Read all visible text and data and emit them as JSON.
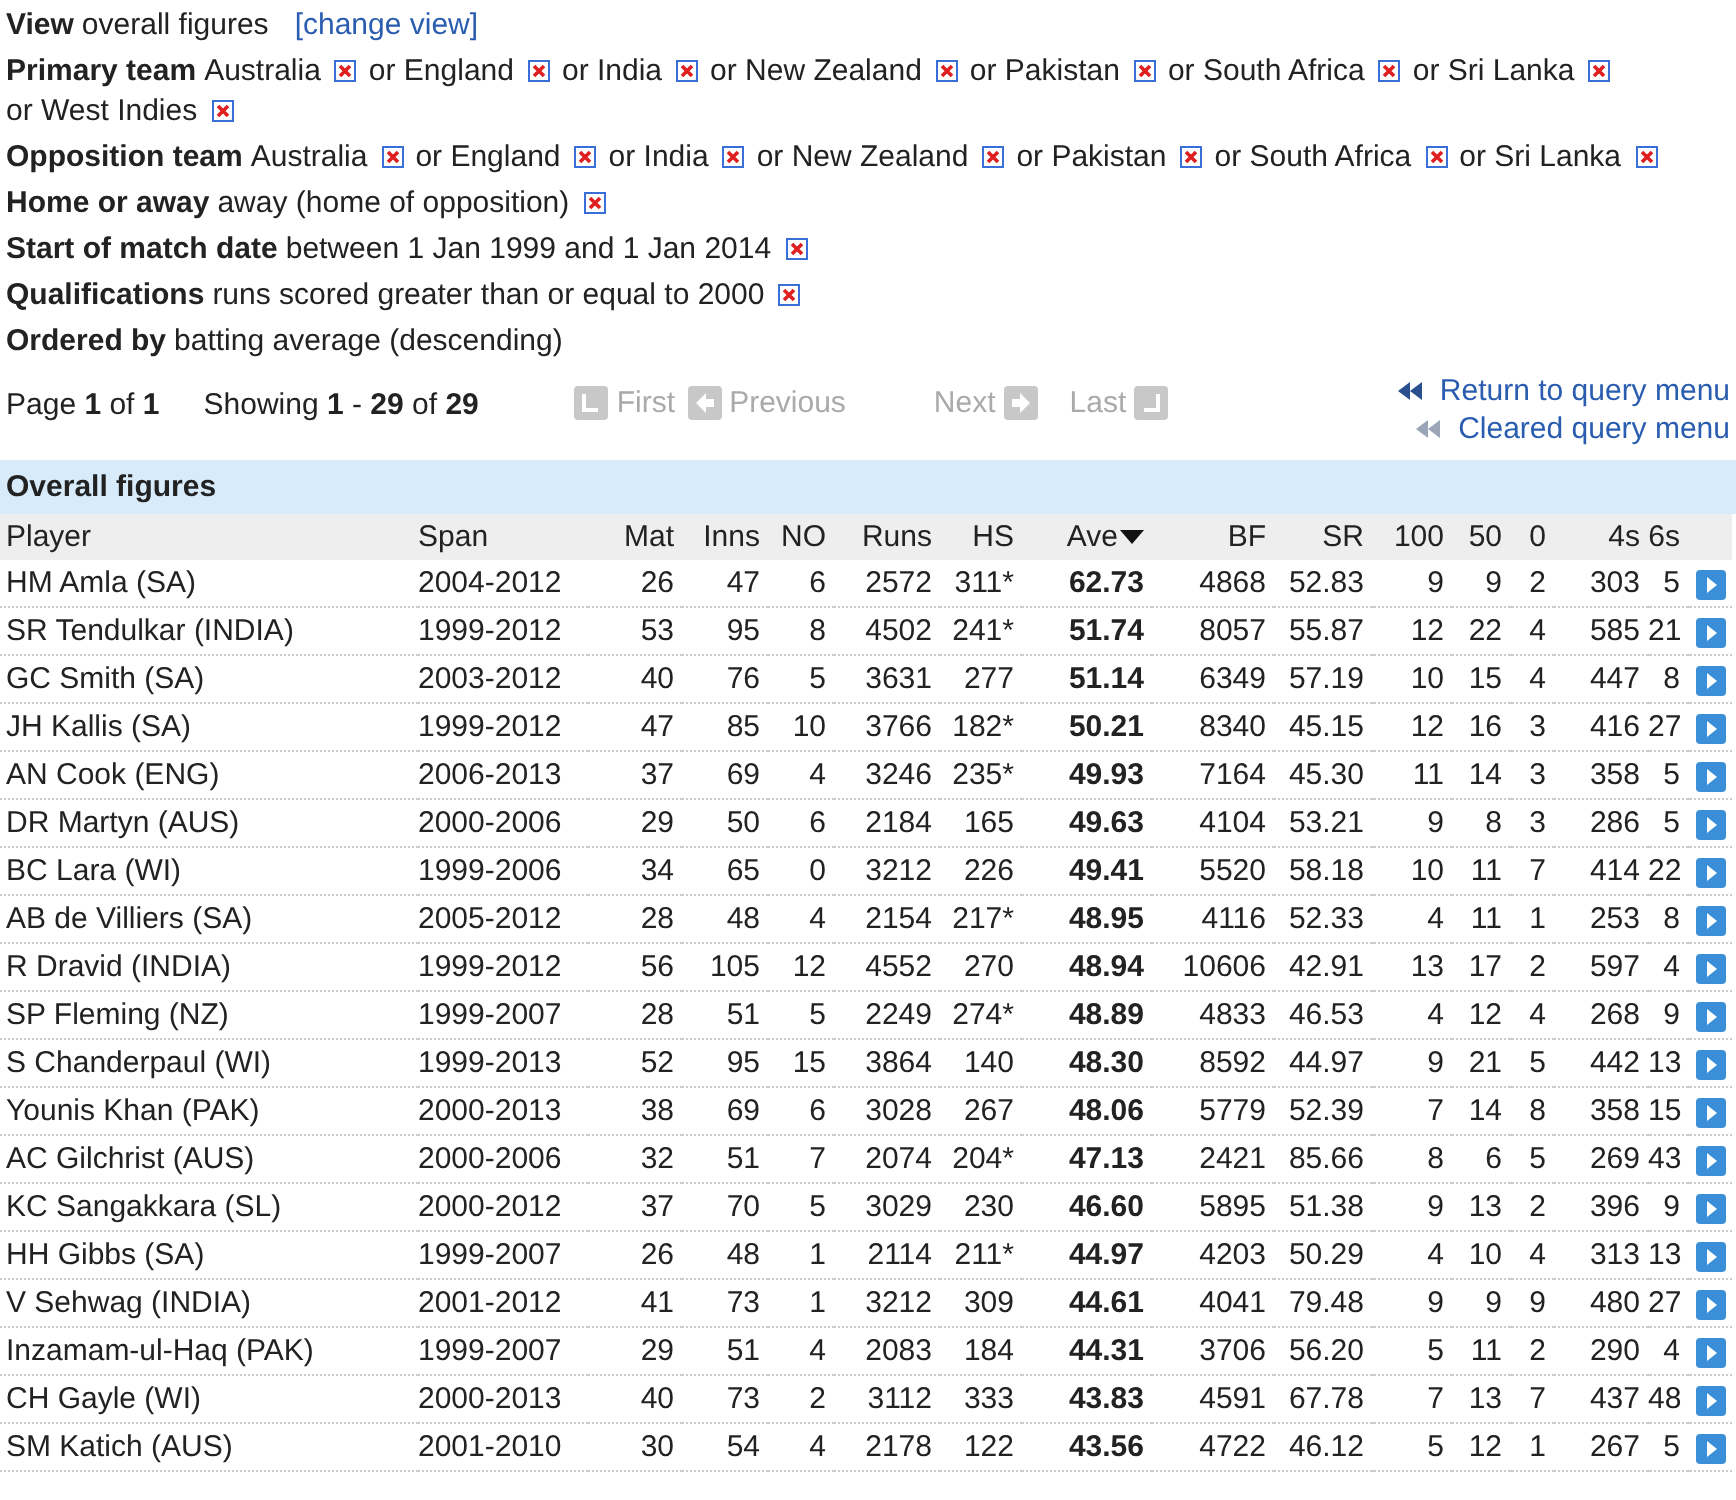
{
  "filters": [
    {
      "label": "View",
      "items": [
        {
          "text": "overall figures",
          "removable": false
        }
      ],
      "link": "[change view]"
    },
    {
      "label": "Primary team",
      "items": [
        {
          "text": "Australia",
          "removable": true
        },
        {
          "text": "or England",
          "removable": true
        },
        {
          "text": "or India",
          "removable": true
        },
        {
          "text": "or New Zealand",
          "removable": true
        },
        {
          "text": "or Pakistan",
          "removable": true
        },
        {
          "text": "or South Africa",
          "removable": true
        },
        {
          "text": "or Sri Lanka",
          "removable": true
        },
        {
          "text": "or West Indies",
          "removable": true
        }
      ]
    },
    {
      "label": "Opposition team",
      "items": [
        {
          "text": "Australia",
          "removable": true
        },
        {
          "text": "or England",
          "removable": true
        },
        {
          "text": "or India",
          "removable": true
        },
        {
          "text": "or New Zealand",
          "removable": true
        },
        {
          "text": "or Pakistan",
          "removable": true
        },
        {
          "text": "or South Africa",
          "removable": true
        },
        {
          "text": "or Sri Lanka",
          "removable": true
        }
      ]
    },
    {
      "label": "Home or away",
      "items": [
        {
          "text": "away (home of opposition)",
          "removable": true
        }
      ]
    },
    {
      "label": "Start of match date",
      "items": [
        {
          "text": "between 1 Jan 1999 and 1 Jan 2014",
          "removable": true
        }
      ]
    },
    {
      "label": "Qualifications",
      "items": [
        {
          "text": "runs scored greater than or equal to 2000",
          "removable": true
        }
      ]
    },
    {
      "label": "Ordered by",
      "items": [
        {
          "text": "batting average (descending)",
          "removable": false
        }
      ]
    }
  ],
  "pager": {
    "page": "Page **1** of **1**",
    "showing": "Showing **1** - **29** of **29**",
    "nav": [
      {
        "label": "First",
        "kind": "first",
        "disabled": true
      },
      {
        "label": "Previous",
        "kind": "previous",
        "disabled": true
      },
      {
        "label": "Next",
        "kind": "next",
        "disabled": true
      },
      {
        "label": "Last",
        "kind": "last",
        "disabled": true
      }
    ],
    "links": [
      {
        "label": "Return to query menu",
        "kind": "return"
      },
      {
        "label": "Cleared query menu",
        "kind": "cleared"
      }
    ]
  },
  "table": {
    "title": "Overall figures",
    "columns": [
      {
        "label": "Player",
        "sorted": false
      },
      {
        "label": "Span",
        "sorted": false
      },
      {
        "label": "Mat",
        "sorted": false
      },
      {
        "label": "Inns",
        "sorted": false
      },
      {
        "label": "NO",
        "sorted": false
      },
      {
        "label": "Runs",
        "sorted": false
      },
      {
        "label": "HS",
        "sorted": false
      },
      {
        "label": "Ave",
        "sorted": true
      },
      {
        "label": "BF",
        "sorted": false
      },
      {
        "label": "SR",
        "sorted": false
      },
      {
        "label": "100",
        "sorted": false
      },
      {
        "label": "50",
        "sorted": false
      },
      {
        "label": "0",
        "sorted": false
      },
      {
        "label": "4s",
        "sorted": false
      },
      {
        "label": "6s",
        "sorted": false
      }
    ],
    "rows": [
      [
        "HM Amla (SA)",
        "2004-2012",
        "26",
        "47",
        "6",
        "2572",
        "311*",
        "62.73",
        "4868",
        "52.83",
        "9",
        "9",
        "2",
        "303",
        "5"
      ],
      [
        "SR Tendulkar (INDIA)",
        "1999-2012",
        "53",
        "95",
        "8",
        "4502",
        "241*",
        "51.74",
        "8057",
        "55.87",
        "12",
        "22",
        "4",
        "585",
        "21"
      ],
      [
        "GC Smith (SA)",
        "2003-2012",
        "40",
        "76",
        "5",
        "3631",
        "277",
        "51.14",
        "6349",
        "57.19",
        "10",
        "15",
        "4",
        "447",
        "8"
      ],
      [
        "JH Kallis (SA)",
        "1999-2012",
        "47",
        "85",
        "10",
        "3766",
        "182*",
        "50.21",
        "8340",
        "45.15",
        "12",
        "16",
        "3",
        "416",
        "27"
      ],
      [
        "AN Cook (ENG)",
        "2006-2013",
        "37",
        "69",
        "4",
        "3246",
        "235*",
        "49.93",
        "7164",
        "45.30",
        "11",
        "14",
        "3",
        "358",
        "5"
      ],
      [
        "DR Martyn (AUS)",
        "2000-2006",
        "29",
        "50",
        "6",
        "2184",
        "165",
        "49.63",
        "4104",
        "53.21",
        "9",
        "8",
        "3",
        "286",
        "5"
      ],
      [
        "BC Lara (WI)",
        "1999-2006",
        "34",
        "65",
        "0",
        "3212",
        "226",
        "49.41",
        "5520",
        "58.18",
        "10",
        "11",
        "7",
        "414",
        "22"
      ],
      [
        "AB de Villiers (SA)",
        "2005-2012",
        "28",
        "48",
        "4",
        "2154",
        "217*",
        "48.95",
        "4116",
        "52.33",
        "4",
        "11",
        "1",
        "253",
        "8"
      ],
      [
        "R Dravid (INDIA)",
        "1999-2012",
        "56",
        "105",
        "12",
        "4552",
        "270",
        "48.94",
        "10606",
        "42.91",
        "13",
        "17",
        "2",
        "597",
        "4"
      ],
      [
        "SP Fleming (NZ)",
        "1999-2007",
        "28",
        "51",
        "5",
        "2249",
        "274*",
        "48.89",
        "4833",
        "46.53",
        "4",
        "12",
        "4",
        "268",
        "9"
      ],
      [
        "S Chanderpaul (WI)",
        "1999-2013",
        "52",
        "95",
        "15",
        "3864",
        "140",
        "48.30",
        "8592",
        "44.97",
        "9",
        "21",
        "5",
        "442",
        "13"
      ],
      [
        "Younis Khan (PAK)",
        "2000-2013",
        "38",
        "69",
        "6",
        "3028",
        "267",
        "48.06",
        "5779",
        "52.39",
        "7",
        "14",
        "8",
        "358",
        "15"
      ],
      [
        "AC Gilchrist (AUS)",
        "2000-2006",
        "32",
        "51",
        "7",
        "2074",
        "204*",
        "47.13",
        "2421",
        "85.66",
        "8",
        "6",
        "5",
        "269",
        "43"
      ],
      [
        "KC Sangakkara (SL)",
        "2000-2012",
        "37",
        "70",
        "5",
        "3029",
        "230",
        "46.60",
        "5895",
        "51.38",
        "9",
        "13",
        "2",
        "396",
        "9"
      ],
      [
        "HH Gibbs (SA)",
        "1999-2007",
        "26",
        "48",
        "1",
        "2114",
        "211*",
        "44.97",
        "4203",
        "50.29",
        "4",
        "10",
        "4",
        "313",
        "13"
      ],
      [
        "V Sehwag (INDIA)",
        "2001-2012",
        "41",
        "73",
        "1",
        "3212",
        "309",
        "44.61",
        "4041",
        "79.48",
        "9",
        "9",
        "9",
        "480",
        "27"
      ],
      [
        "Inzamam-ul-Haq (PAK)",
        "1999-2007",
        "29",
        "51",
        "4",
        "2083",
        "184",
        "44.31",
        "3706",
        "56.20",
        "5",
        "11",
        "2",
        "290",
        "4"
      ],
      [
        "CH Gayle (WI)",
        "2000-2013",
        "40",
        "73",
        "2",
        "3112",
        "333",
        "43.83",
        "4591",
        "67.78",
        "7",
        "13",
        "7",
        "437",
        "48"
      ],
      [
        "SM Katich (AUS)",
        "2001-2010",
        "30",
        "54",
        "4",
        "2178",
        "122",
        "43.56",
        "4722",
        "46.12",
        "5",
        "12",
        "1",
        "267",
        "5"
      ]
    ]
  }
}
